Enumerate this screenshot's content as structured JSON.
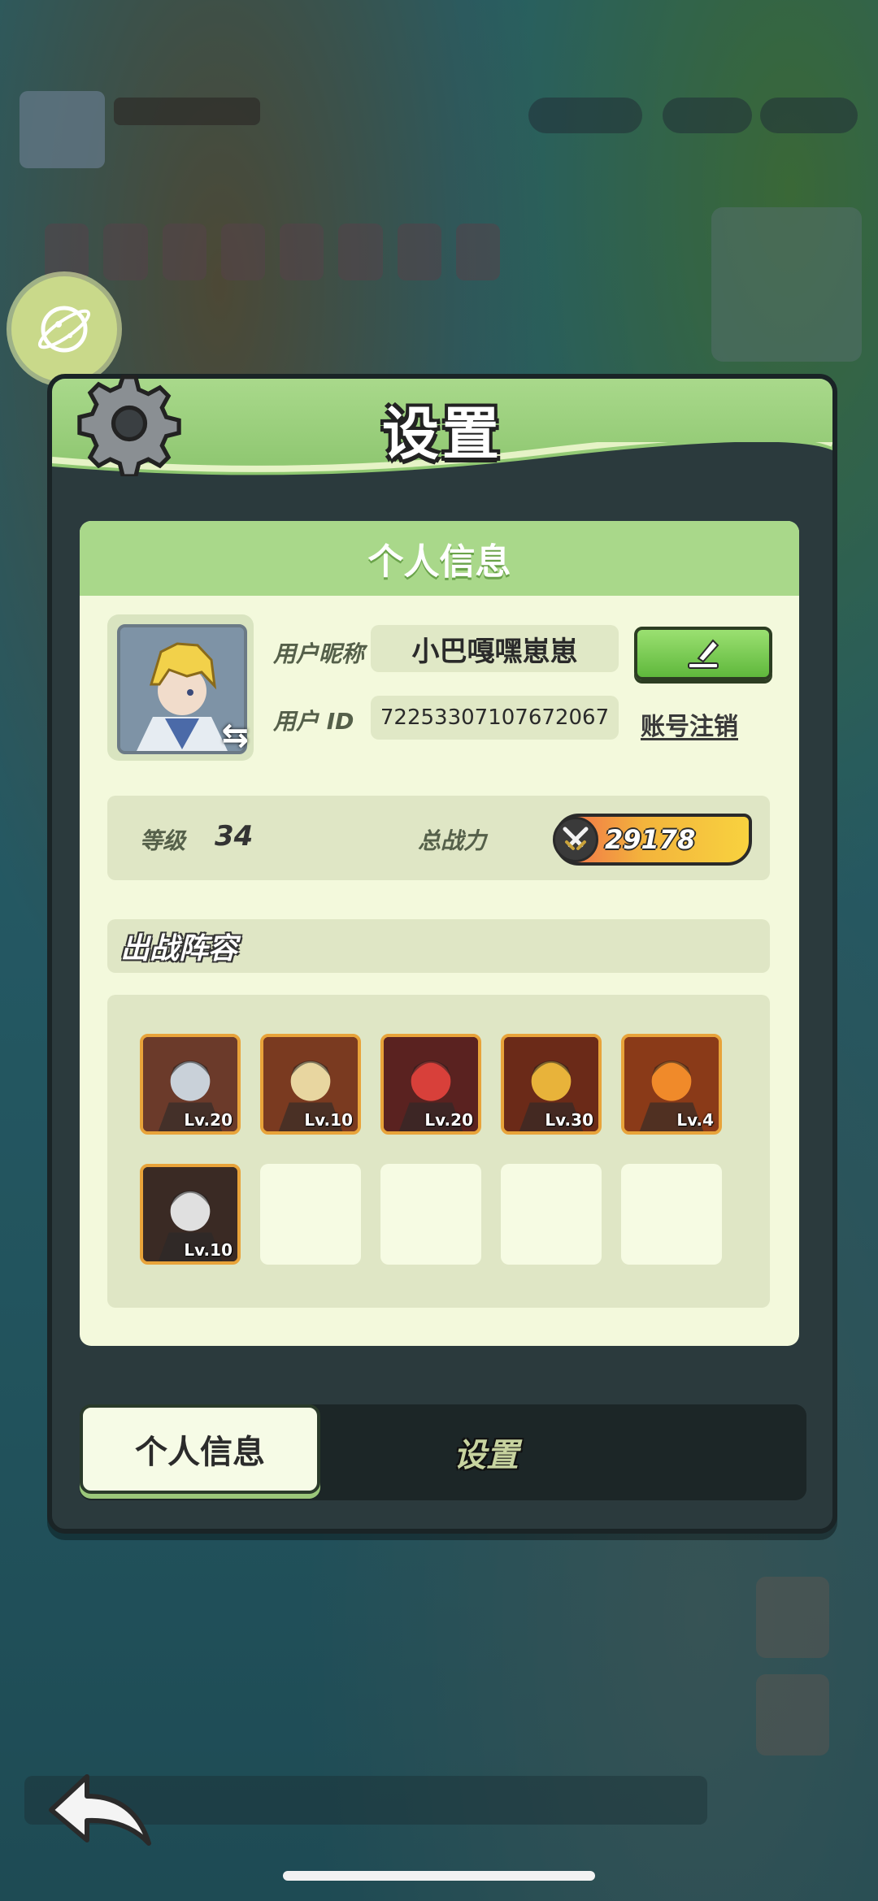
{
  "dialog": {
    "title": "设置"
  },
  "profile_panel": {
    "header": "个人信息",
    "nickname_label": "用户昵称",
    "nickname_value": "小巴嘎嘿崽崽",
    "user_id_label": "用户  ID",
    "user_id_value": "72253307107672067",
    "cancel_account_label": "账号注销",
    "level_label": "等级",
    "level_value": "34",
    "power_label": "总战力",
    "power_value": "29178"
  },
  "lineup": {
    "header": "出战阵容",
    "heroes": [
      {
        "level": "Lv.20",
        "color": "#6b3a2a",
        "accent": "#c9d1d9"
      },
      {
        "level": "Lv.10",
        "color": "#7a3a20",
        "accent": "#e8d6a0"
      },
      {
        "level": "Lv.20",
        "color": "#5a2220",
        "accent": "#d8403a"
      },
      {
        "level": "Lv.30",
        "color": "#6b2a18",
        "accent": "#e8b33a"
      },
      {
        "level": "Lv.4",
        "color": "#8a3a18",
        "accent": "#f08a2a"
      },
      {
        "level": "Lv.10",
        "color": "#3a2a24",
        "accent": "#e0e0e0"
      }
    ],
    "empty_slots": 4
  },
  "tabs": {
    "active_label": "个人信息",
    "inactive_label": "设置"
  },
  "icons": {
    "settings": "gear-icon",
    "edit": "pencil-icon",
    "back": "back-arrow-icon",
    "avatar_swap": "swap-icon",
    "power": "crossed-swords-icon",
    "planet": "planet-icon"
  }
}
